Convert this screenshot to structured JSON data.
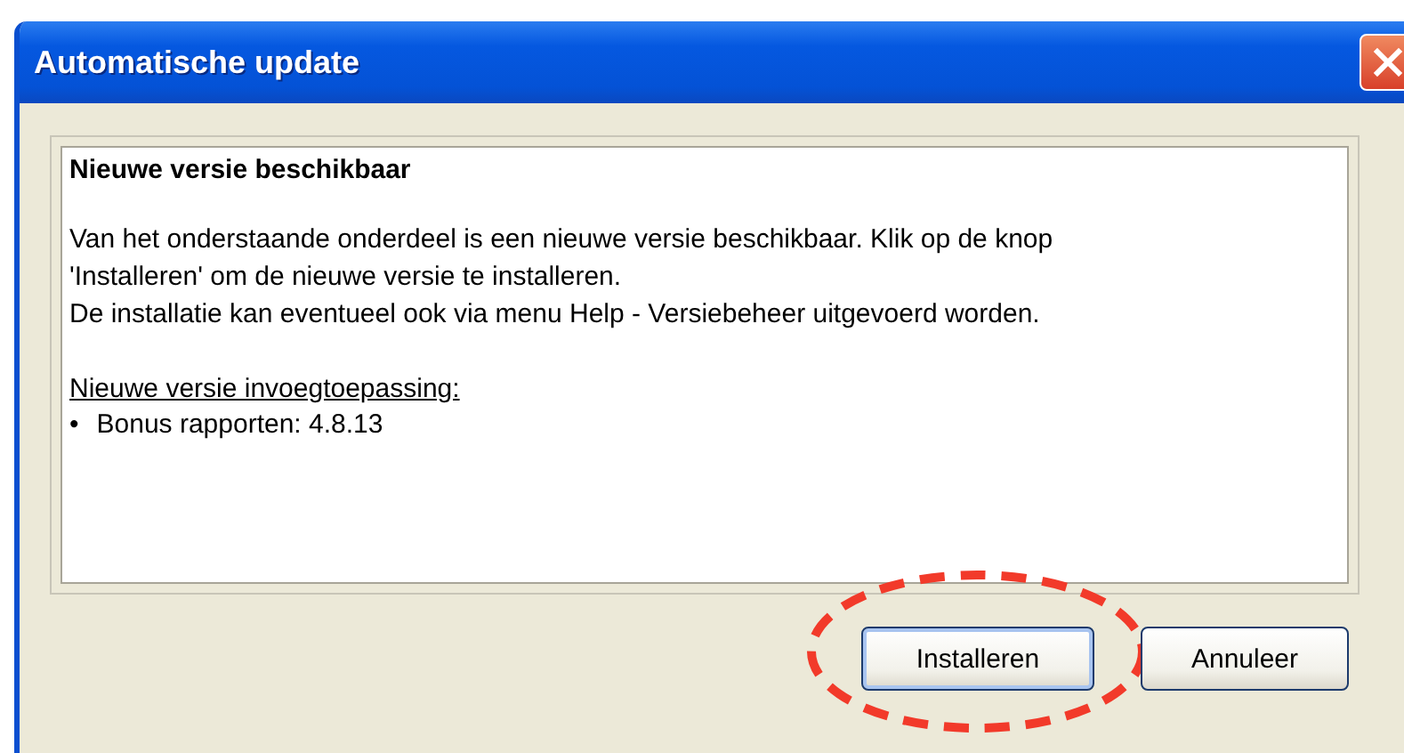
{
  "window": {
    "title": "Automatische update"
  },
  "panel": {
    "heading": "Nieuwe versie beschikbaar",
    "message_lines": [
      "Van het onderstaande onderdeel is een nieuwe versie beschikbaar. Klik op de knop",
      "'Installeren' om de nieuwe versie te installeren.",
      "De installatie kan eventueel ook via menu Help - Versiebeheer uitgevoerd worden."
    ],
    "list_heading": "Nieuwe versie invoegtoepassing:",
    "items": [
      {
        "bullet": "•",
        "text": "Bonus rapporten: 4.8.13"
      }
    ]
  },
  "buttons": [
    {
      "label": "Installeren",
      "default": true,
      "highlighted": true
    },
    {
      "label": "Annuleer",
      "default": false,
      "highlighted": false
    }
  ]
}
